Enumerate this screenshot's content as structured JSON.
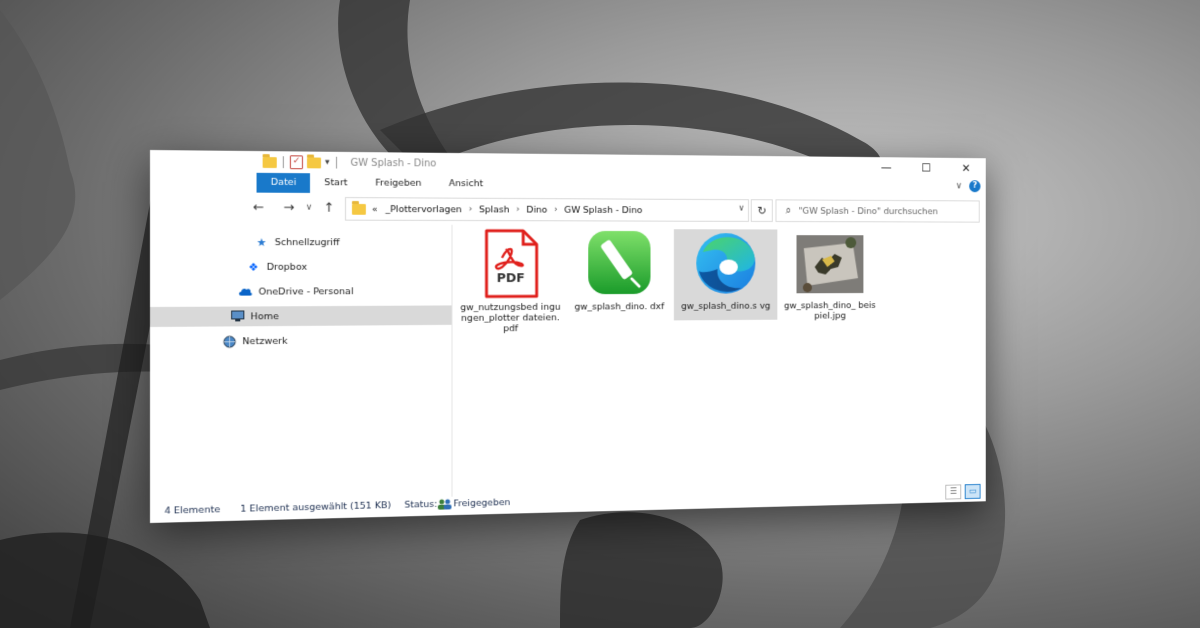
{
  "window": {
    "title": "GW Splash - Dino",
    "controls": {
      "minimize": "—",
      "maximize": "☐",
      "close": "✕"
    }
  },
  "ribbon": {
    "tabs": [
      "Datei",
      "Start",
      "Freigeben",
      "Ansicht"
    ],
    "active_color": "#1979ca"
  },
  "nav": {
    "back": "←",
    "forward": "→",
    "recent": "∨",
    "up": "↑",
    "prefix": "«",
    "breadcrumb": [
      "_Plottervorlagen",
      "Splash",
      "Dino",
      "GW Splash - Dino"
    ],
    "refresh": "↻",
    "search_placeholder": "\"GW Splash - Dino\" durchsuchen"
  },
  "sidebar": {
    "items": [
      {
        "label": "Schnellzugriff",
        "icon": "star-icon"
      },
      {
        "label": "Dropbox",
        "icon": "dropbox-icon"
      },
      {
        "label": "OneDrive - Personal",
        "icon": "cloud-icon"
      },
      {
        "label": "Home",
        "icon": "monitor-icon"
      },
      {
        "label": "Netzwerk",
        "icon": "network-icon"
      }
    ]
  },
  "files": [
    {
      "name": "gw_nutzungsbedingungen_plotterdateien.pdf",
      "display": "gw_nutzungsbed ingungen_plotter dateien.pdf",
      "icon": "pdf-icon",
      "badge": "PDF"
    },
    {
      "name": "gw_splash_dino.dxf",
      "display": "gw_splash_dino. dxf",
      "icon": "dxf-app-icon"
    },
    {
      "name": "gw_splash_dino.svg",
      "display": "gw_splash_dino.s vg",
      "icon": "edge-browser-icon"
    },
    {
      "name": "gw_splash_dino_beispiel.jpg",
      "display": "gw_splash_dino_ beispiel.jpg",
      "icon": "image-thumbnail"
    }
  ],
  "status": {
    "count": "4 Elemente",
    "selection": "1 Element ausgewählt (151 KB)",
    "status_label": "Status:",
    "status_value": "Freigegeben"
  }
}
